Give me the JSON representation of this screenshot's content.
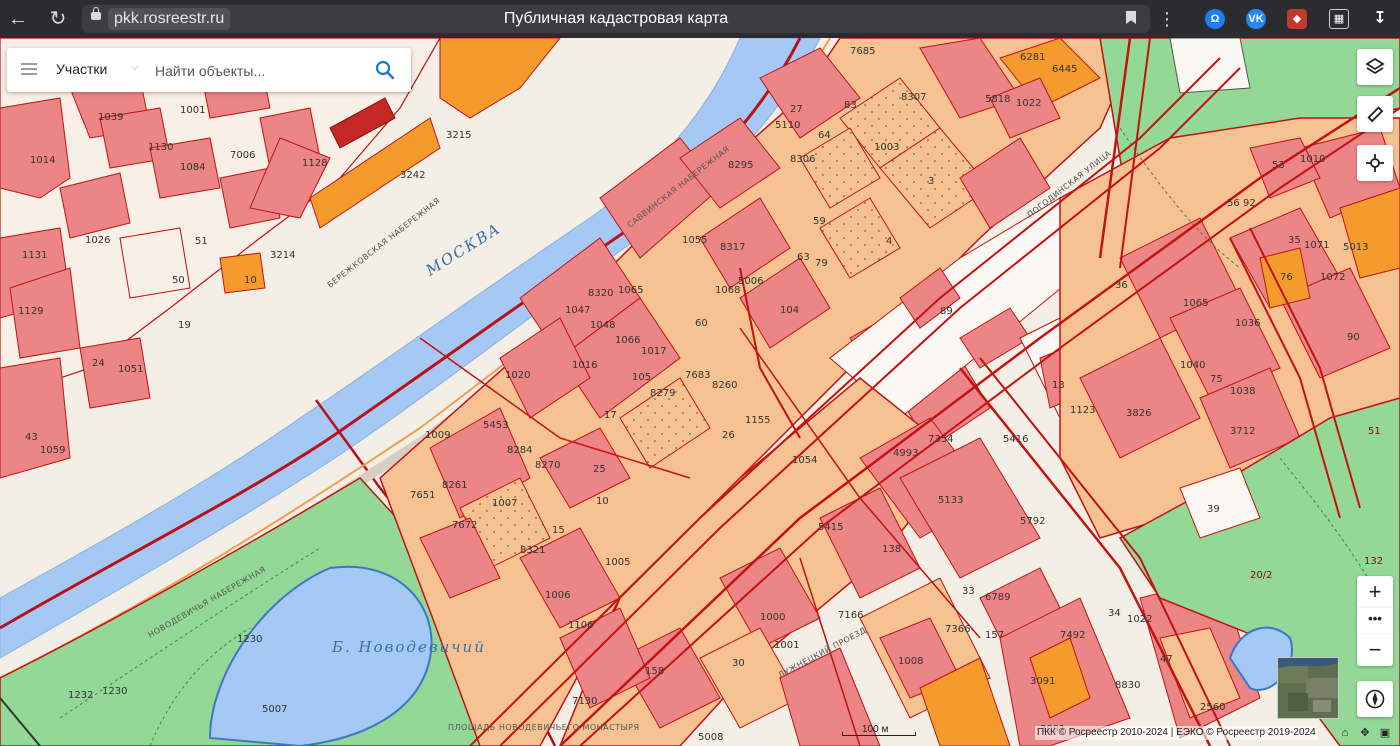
{
  "browser": {
    "url": "pkk.rosreestr.ru",
    "title": "Публичная кадастровая карта"
  },
  "search": {
    "category": "Участки",
    "placeholder": "Найти объекты..."
  },
  "map": {
    "river_label": "МОСКВА",
    "pond_label": "Б. Новодевичий",
    "streets": [
      "САВВИНСКАЯ НАБЕРЕЖНАЯ",
      "БЕРЕЖКОВСКАЯ НАБЕРЕЖНАЯ",
      "НОВОДЕВИЧЬЯ НАБЕРЕЖНАЯ",
      "ПЛОЩАДЬ НОВОДЕВИЧЬЕГО МОНАСТЫРЯ",
      "ЛУЖНЕЦКИЙ ПРОЕЗД",
      "ПОГОДИНСКАЯ УЛИЦА"
    ],
    "labels": [
      "7006",
      "1014",
      "1039",
      "1001",
      "1130",
      "1084",
      "1128",
      "1026",
      "1129",
      "1131",
      "24",
      "1051",
      "43",
      "1059",
      "19",
      "50",
      "51",
      "10",
      "3214",
      "3215",
      "3242",
      "1055",
      "8317",
      "8320",
      "1065",
      "1047",
      "1048",
      "1066",
      "1060",
      "1068",
      "5006",
      "104",
      "60",
      "1017",
      "7683",
      "8279",
      "8260",
      "105",
      "17",
      "1020",
      "1016",
      "1009",
      "5453",
      "8284",
      "8270",
      "25",
      "1007",
      "8261",
      "7651",
      "7672",
      "8321",
      "15",
      "10",
      "1005",
      "1006",
      "1106",
      "1155",
      "26",
      "1054",
      "5415",
      "138",
      "4993",
      "7354",
      "5133",
      "5416",
      "4",
      "3",
      "59",
      "63",
      "79",
      "83",
      "1003",
      "8307",
      "5818",
      "1022",
      "6281",
      "6445",
      "7685",
      "89",
      "13",
      "1123",
      "3826",
      "1040",
      "1038",
      "3712",
      "75",
      "36",
      "1065",
      "1036",
      "5013",
      "1072",
      "1071",
      "35",
      "76",
      "90",
      "53",
      "1010",
      "56",
      "92",
      "39",
      "1022",
      "34",
      "47",
      "7492",
      "1007",
      "3091",
      "2560",
      "8830",
      "1008",
      "1000",
      "30",
      "1001",
      "158",
      "7130",
      "5008",
      "5007",
      "1230",
      "1230",
      "1232",
      "7166",
      "7366",
      "6789",
      "33",
      "157",
      "6286",
      "8295",
      "8306",
      "5110",
      "27",
      "64"
    ],
    "scale_label": "100 м",
    "attribution": "ПКК © Росреестр 2010-2024 | ЕЭКО © Росреестр 2019-2024"
  },
  "icons": {
    "layers": "layers-icon",
    "ruler": "ruler-icon",
    "locate": "crosshair-icon",
    "zoom_in": "+",
    "more": "•••",
    "zoom_out": "−",
    "compass": "compass-icon"
  },
  "colors": {
    "parcel_fill": "#ec8586",
    "parcel_stroke": "#c31212",
    "block_fill": "#f6c292",
    "water": "#a5c8f5",
    "park": "#93d896",
    "orange": "#f59b2e"
  }
}
